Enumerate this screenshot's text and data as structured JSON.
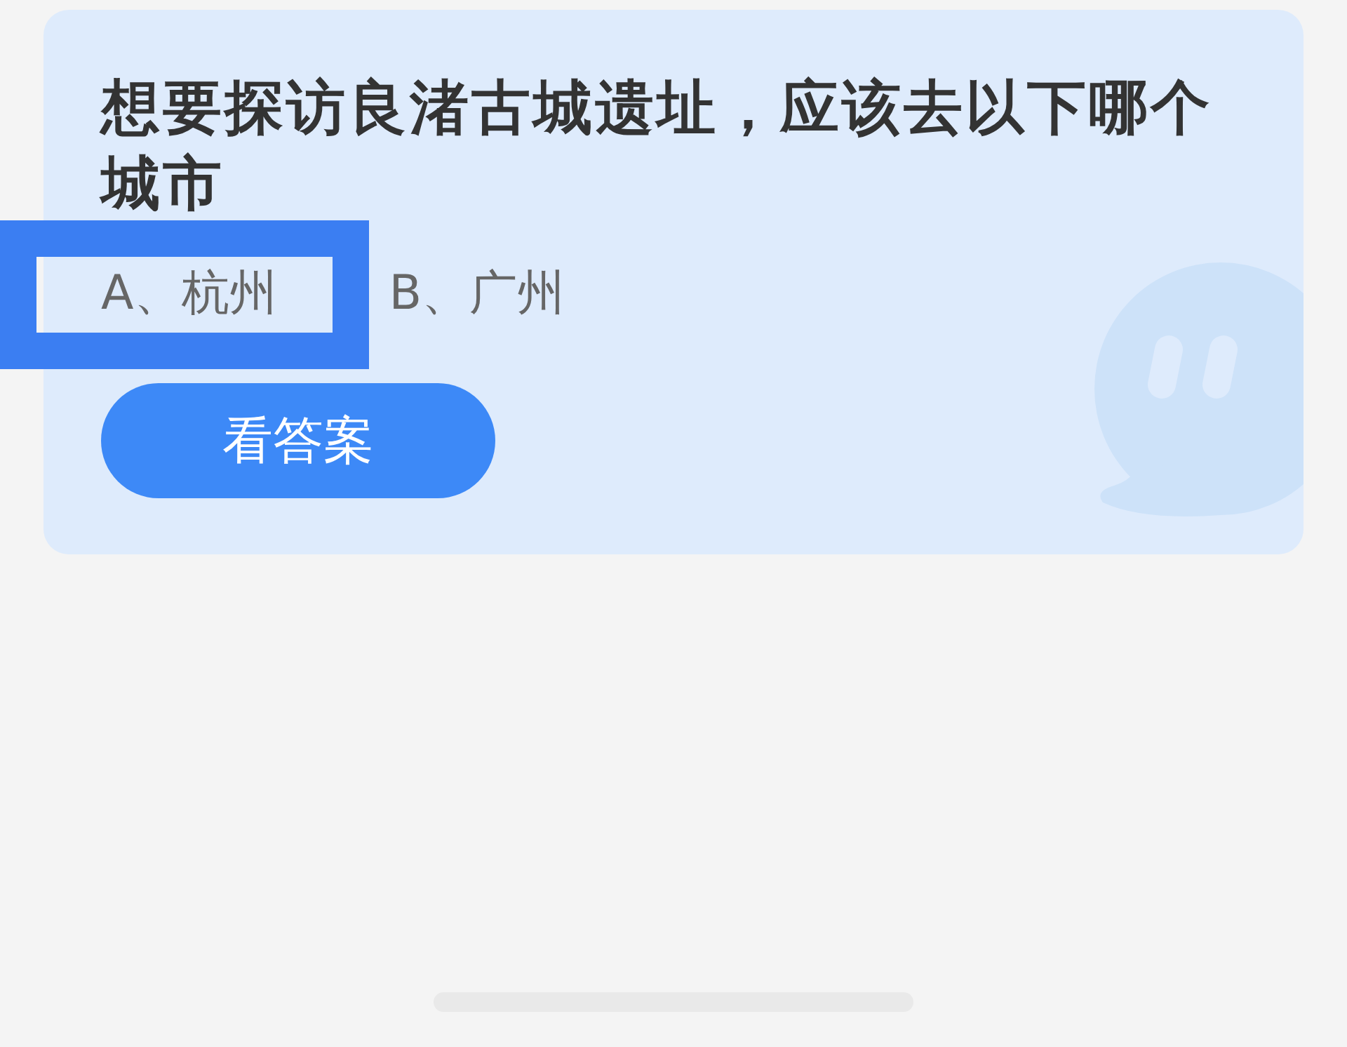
{
  "card": {
    "question": "想要探访良渚古城遗址，应该去以下哪个城市",
    "options": [
      {
        "label": "A、杭州",
        "highlighted": true
      },
      {
        "label": "B、广州",
        "highlighted": false
      }
    ],
    "answer_button": "看答案"
  }
}
